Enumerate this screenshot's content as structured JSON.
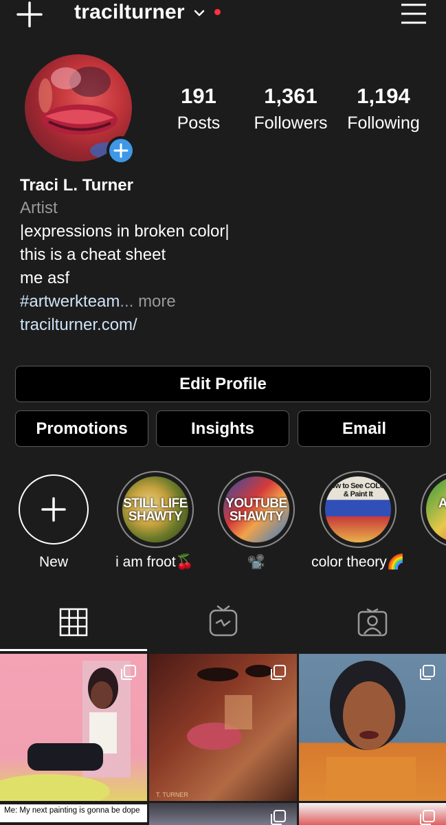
{
  "header": {
    "username": "tracilturner",
    "notification_dot_color": "#ff3040"
  },
  "stats": {
    "posts": {
      "value": "191",
      "label": "Posts"
    },
    "followers": {
      "value": "1,361",
      "label": "Followers"
    },
    "following": {
      "value": "1,194",
      "label": "Following"
    }
  },
  "bio": {
    "name": "Traci L. Turner",
    "category": "Artist",
    "lines": [
      "|expressions in broken color|",
      "this is a cheat sheet",
      "me asf"
    ],
    "hashtag": "#artwerkteam",
    "more": "... more",
    "website": "tracilturner.com/"
  },
  "buttons": {
    "edit_profile": "Edit Profile",
    "promotions": "Promotions",
    "insights": "Insights",
    "email": "Email"
  },
  "highlights": [
    {
      "label": "New",
      "icon": "plus-icon"
    },
    {
      "label": "i am froot🍒",
      "cover_text": "STILL LIFE SHAWTY"
    },
    {
      "label": "📽️",
      "cover_text": "YOUTUBE SHAWTY"
    },
    {
      "label": "color theory🌈",
      "cover_text": "How to See COLOR & Paint It"
    },
    {
      "label": "",
      "cover_text": "A SH"
    }
  ],
  "tabs": [
    {
      "icon": "grid-icon",
      "active": true
    },
    {
      "icon": "igtv-icon",
      "active": false
    },
    {
      "icon": "tagged-icon",
      "active": false
    }
  ],
  "grid": {
    "caption": "Me: My next painting is gonna be dope",
    "signature_1": "T. TURNER"
  },
  "colors": {
    "background": "#1c1c1c",
    "accent_blue": "#3f98e7",
    "link": "#cfe3f8",
    "muted": "#9a9a9a"
  }
}
